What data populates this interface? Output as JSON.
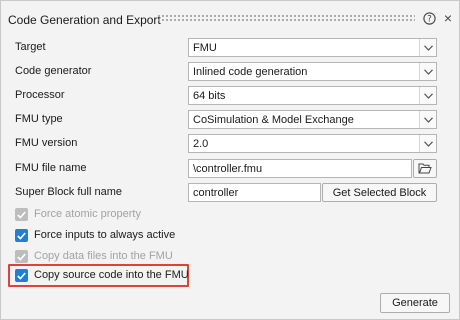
{
  "panel": {
    "title": "Code Generation and Export",
    "help_glyph": "?",
    "close_glyph": "×"
  },
  "fields": {
    "target": {
      "label": "Target",
      "value": "FMU"
    },
    "code_generator": {
      "label": "Code generator",
      "value": "Inlined code generation"
    },
    "processor": {
      "label": "Processor",
      "value": "64 bits"
    },
    "fmu_type": {
      "label": "FMU type",
      "value": "CoSimulation & Model Exchange"
    },
    "fmu_version": {
      "label": "FMU version",
      "value": "2.0"
    },
    "fmu_file_name": {
      "label": "FMU file name",
      "value": "\\controller.fmu"
    },
    "super_block": {
      "label": "Super Block full name",
      "value": "controller",
      "button_label": "Get Selected Block"
    }
  },
  "options": [
    {
      "label": "Force atomic property",
      "checked": true,
      "enabled": false
    },
    {
      "label": "Force inputs to always active",
      "checked": true,
      "enabled": true
    },
    {
      "label": "Copy data files into the FMU",
      "checked": true,
      "enabled": false
    },
    {
      "label": "Copy source code into the FMU",
      "checked": true,
      "enabled": true
    }
  ],
  "footer": {
    "generate_label": "Generate"
  },
  "colors": {
    "accent": "#1e7fd6",
    "highlight": "#e0413b",
    "disabled": "#bdbdbd"
  },
  "icons": {
    "help": "help-circle-icon",
    "close": "close-icon",
    "browse": "folder-open-icon",
    "dropdown": "chevron-down-icon",
    "check": "checkmark-icon"
  }
}
